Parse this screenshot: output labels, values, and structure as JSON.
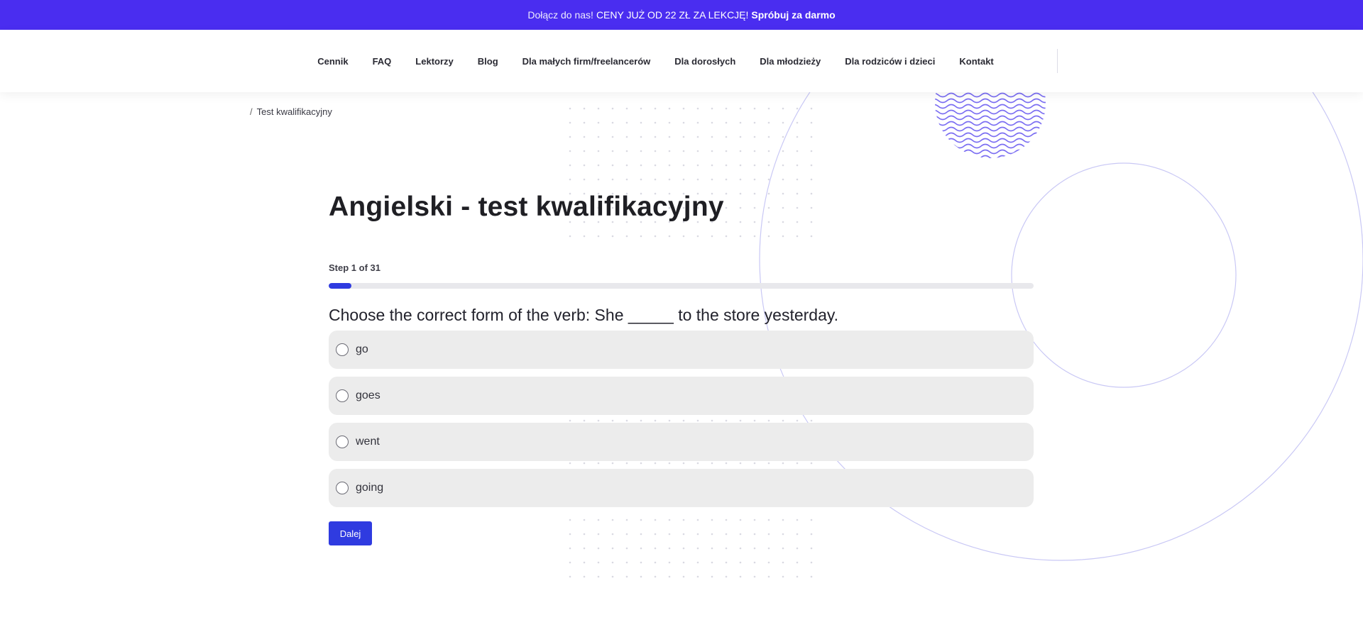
{
  "promo": {
    "intro": "Dołącz do nas!",
    "price": "CENY JUŻ OD 22 ZŁ ZA LEKCJĘ!",
    "cta": "Spróbuj za darmo"
  },
  "nav": {
    "items": [
      {
        "label": "Cennik"
      },
      {
        "label": "FAQ"
      },
      {
        "label": "Lektorzy"
      },
      {
        "label": "Blog"
      },
      {
        "label": "Dla małych firm/freelancerów"
      },
      {
        "label": "Dla dorosłych"
      },
      {
        "label": "Dla młodzieży"
      },
      {
        "label": "Dla rodziców i dzieci"
      },
      {
        "label": "Kontakt"
      }
    ]
  },
  "breadcrumb": {
    "separator": "/",
    "current": "Test kwalifikacyjny"
  },
  "test": {
    "title": "Angielski - test kwalifikacyjny",
    "step_label": "Step 1 of 31",
    "progress_fraction": 0.032,
    "question": "Choose the correct form of the verb: She _____ to the store yesterday.",
    "options": [
      {
        "label": "go"
      },
      {
        "label": "goes"
      },
      {
        "label": "went"
      },
      {
        "label": "going"
      }
    ],
    "next_label": "Dalej"
  },
  "colors": {
    "brand": "#4a2df0",
    "accent": "#2f3be0",
    "option_bg": "#ececec"
  }
}
